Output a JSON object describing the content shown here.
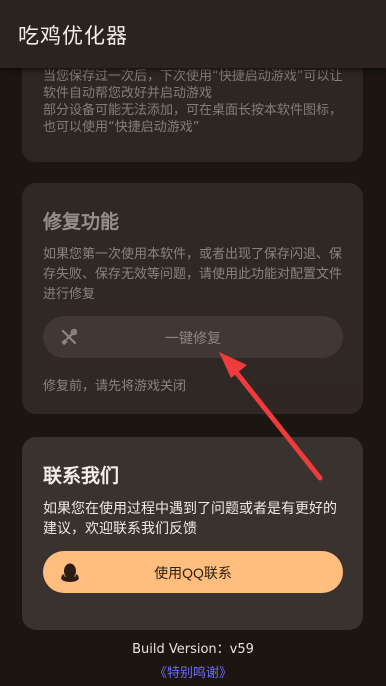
{
  "appbar": {
    "title": "吃鸡优化器"
  },
  "shortcut_card": {
    "text": "当您保存过一次后，下次使用“快捷启动游戏”可以让软件自动帮您改好并启动游戏\n部分设备可能无法添加，可在桌面长按本软件图标，也可以使用“快捷启动游戏”"
  },
  "repair_card": {
    "title": "修复功能",
    "description": "如果您第一次使用本软件，或者出现了保存闪退、保存失败、保存无效等问题，请使用此功能对配置文件进行修复",
    "button_label": "一键修复",
    "button_icon": "tools-icon",
    "note": "修复前，请先将游戏关闭"
  },
  "contact_card": {
    "title": "联系我们",
    "description": "如果您在使用过程中遇到了问题或者是有更好的建议，欢迎联系我们反馈",
    "button_label": "使用QQ联系",
    "button_icon": "qq-penguin-icon"
  },
  "footer": {
    "version": "Build Version：v59",
    "thanks_link": "《特别鸣谢》"
  },
  "colors": {
    "accent": "#ffbd7e",
    "annotation_arrow": "#ee3b3b",
    "link": "#6d6cff"
  }
}
